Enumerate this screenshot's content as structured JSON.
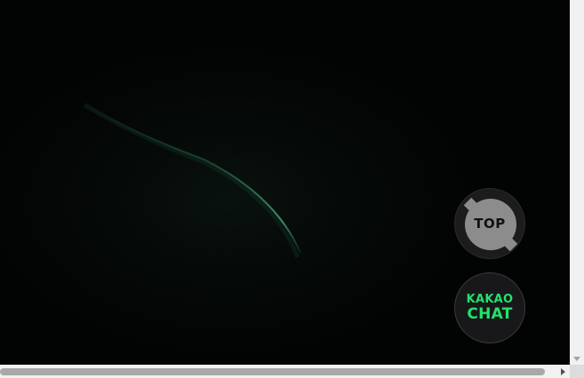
{
  "floating_buttons": {
    "top_label": "TOP",
    "kakao_line1": "KAKAO",
    "kakao_line2": "CHAT"
  },
  "colors": {
    "background": "#020303",
    "glow": "#2d7a52",
    "kakao_text": "#22e36a",
    "top_fill": "#8c8c8c"
  }
}
